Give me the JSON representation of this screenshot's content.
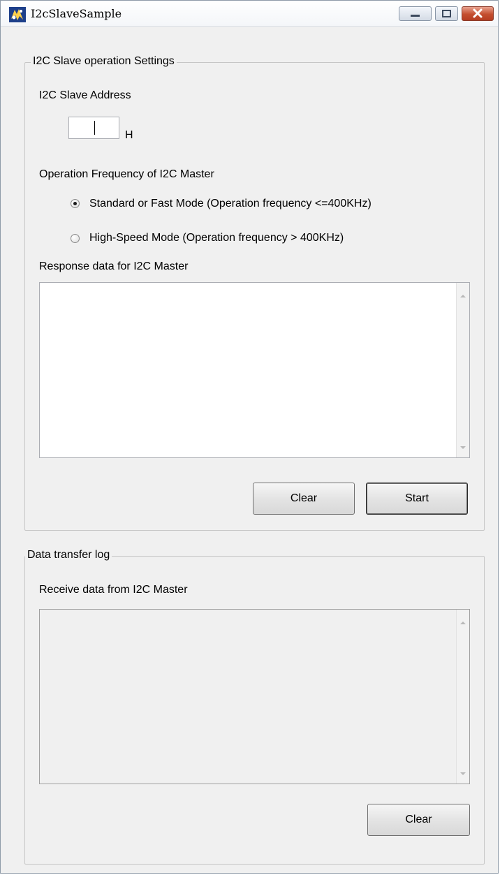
{
  "window": {
    "title": "I2cSlaveSample",
    "controls": {
      "minimize": "minimize-icon",
      "maximize": "maximize-icon",
      "close": "close-icon"
    }
  },
  "settings": {
    "group_title": "I2C Slave operation Settings",
    "address_label": "I2C Slave Address",
    "address_value": "",
    "address_suffix": "H",
    "frequency_label": "Operation Frequency of I2C Master",
    "radio_standard": "Standard or Fast Mode (Operation frequency <=400KHz)",
    "radio_highspeed": "High-Speed Mode (Operation frequency > 400KHz)",
    "selected_mode": "standard",
    "response_label": "Response data for I2C Master",
    "response_value": "",
    "clear_label": "Clear",
    "start_label": "Start"
  },
  "log": {
    "group_title": "Data transfer log",
    "receive_label": "Receive data from I2C Master",
    "receive_value": "",
    "clear_label": "Clear"
  },
  "colors": {
    "window_bg": "#f0f0f0",
    "close_button": "#c44e2f",
    "group_border": "#c6c6c6"
  }
}
